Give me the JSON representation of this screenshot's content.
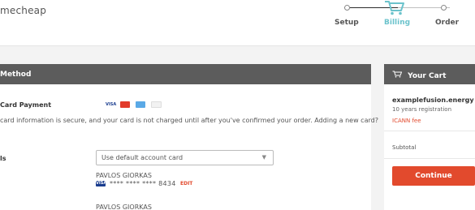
{
  "header": {
    "logo": "mecheap",
    "steps": [
      {
        "label": "Setup"
      },
      {
        "label": "Billing"
      },
      {
        "label": "Order"
      }
    ]
  },
  "payment": {
    "title": "Method",
    "card_payment_label": "Card Payment",
    "card_brands": [
      "VISA",
      "MC",
      "AMEX",
      "DISC"
    ],
    "secure_text": "card information is secure, and your card is not charged until after you've confirmed your order. Adding a new card?",
    "details_label": "ls",
    "card_select": "Use default account card",
    "cardholder_1": "PAVLOS GIORKAS",
    "masked_number": "**** **** **** 8434",
    "edit_label": "EDIT",
    "cardholder_2": "PAVLOS GIORKAS"
  },
  "cart": {
    "title": "Your Cart",
    "domain": "examplefusion.energy",
    "registration": "10 years registration",
    "icann_fee": "ICANN fee",
    "subtotal_label": "Subtotal",
    "continue_label": "Continue"
  },
  "colors": {
    "accent": "#e24a2d",
    "active_step": "#6cc3cc",
    "panel_header": "#5c5c5c"
  }
}
